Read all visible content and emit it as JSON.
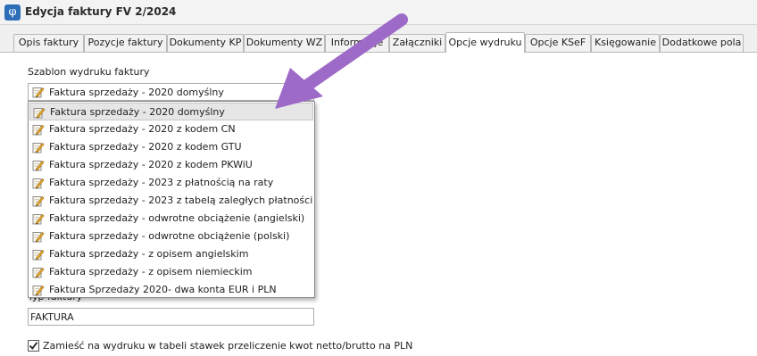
{
  "window": {
    "title": "Edycja faktury FV 2/2024",
    "icon": "phi-app-icon"
  },
  "tabs": [
    {
      "label": "Opis faktury"
    },
    {
      "label": "Pozycje faktury"
    },
    {
      "label": "Dokumenty KP"
    },
    {
      "label": "Dokumenty WZ"
    },
    {
      "label": "Informacje"
    },
    {
      "label": "Załączniki"
    },
    {
      "label": "Opcje wydruku",
      "active": true
    },
    {
      "label": "Opcje KSeF"
    },
    {
      "label": "Księgowanie"
    },
    {
      "label": "Dodatkowe pola"
    }
  ],
  "form": {
    "template_label": "Szablon wydruku faktury",
    "template_value": "Faktura sprzedaży - 2020 domyślny",
    "template_options": [
      "Faktura sprzedaży - 2020 domyślny",
      "Faktura sprzedaży - 2020 z kodem CN",
      "Faktura sprzedaży - 2020 z kodem GTU",
      "Faktura sprzedaży - 2020 z kodem PKWiU",
      "Faktura sprzedaży - 2023 z płatnością na raty",
      "Faktura sprzedaży - 2023 z tabelą zaległych płatności",
      "Faktura sprzedaży - odwrotne obciążenie (angielski)",
      "Faktura sprzedaży - odwrotne obciążenie (polski)",
      "Faktura sprzedaży - z opisem angielskim",
      "Faktura sprzedaży - z opisem niemieckim",
      "Faktura Sprzedaży 2020- dwa konta EUR i PLN"
    ],
    "selected_option": 0,
    "type_label": "Typ faktury",
    "type_value": "FAKTURA",
    "checkbox_label": "Zamieść na wydruku w tabeli stawek przeliczenie kwot netto/brutto na PLN",
    "checkbox_checked": true
  },
  "colors": {
    "accent": "#2c6fb7",
    "arrow": "#9e6ac8",
    "selected_bg": "#e6e6e6"
  }
}
